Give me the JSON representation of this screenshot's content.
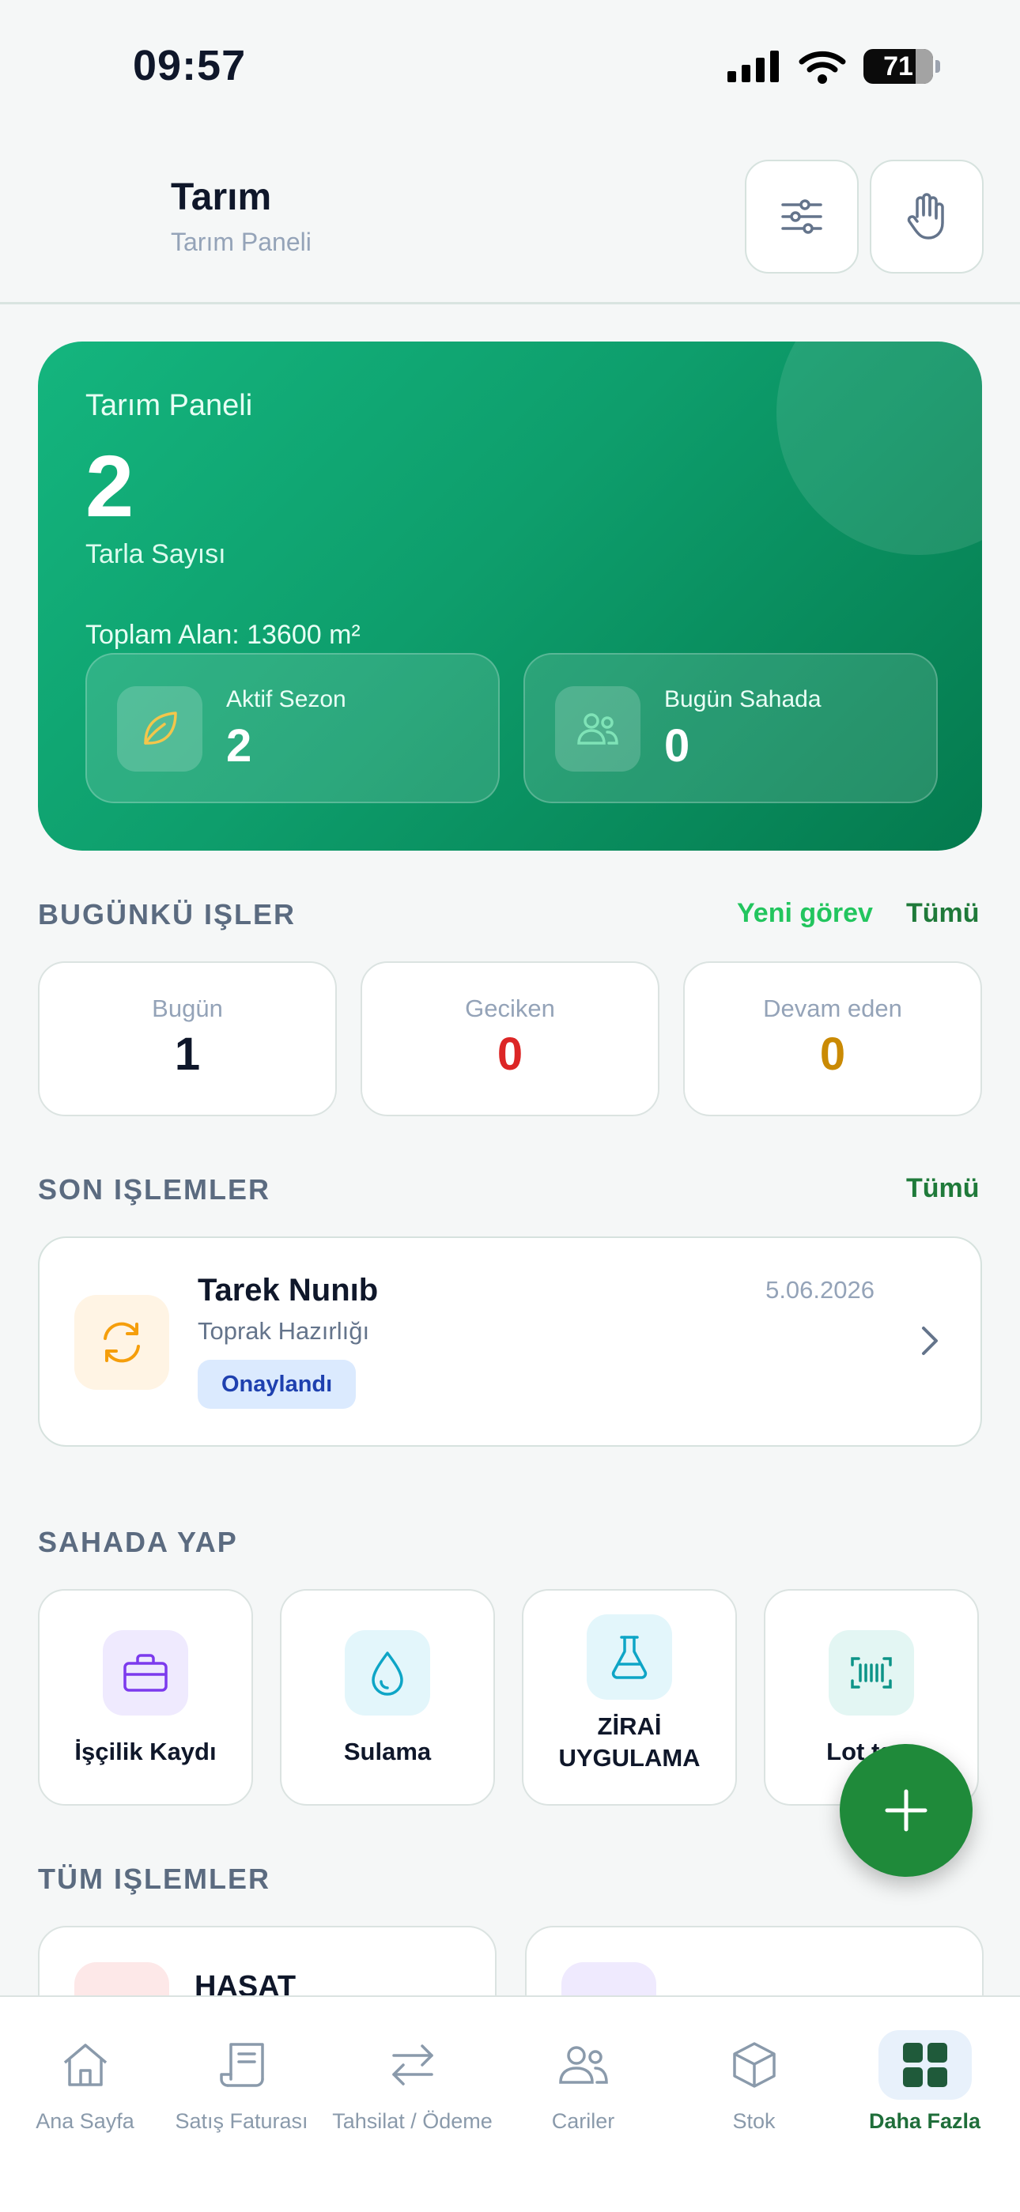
{
  "status_bar": {
    "time": "09:57",
    "battery": "71"
  },
  "header": {
    "title": "Tarım",
    "subtitle": "Tarım Paneli"
  },
  "hero": {
    "label": "Tarım Paneli",
    "value": "2",
    "value_label": "Tarla Sayısı",
    "area": "Toplam Alan: 13600 m²",
    "stats": [
      {
        "label": "Aktif Sezon",
        "value": "2"
      },
      {
        "label": "Bugün Sahada",
        "value": "0"
      }
    ]
  },
  "today": {
    "heading": "BUGÜNKÜ IŞLER",
    "new_task": "Yeni görev",
    "all": "Tümü",
    "tiles": [
      {
        "label": "Bugün",
        "value": "1",
        "color": "#0f172a"
      },
      {
        "label": "Geciken",
        "value": "0",
        "color": "#dc2626"
      },
      {
        "label": "Devam eden",
        "value": "0",
        "color": "#ca8a04"
      }
    ]
  },
  "recent": {
    "heading": "SON IŞLEMLER",
    "all": "Tümü",
    "item": {
      "name": "Tarek Nunıb",
      "date": "5.06.2026",
      "description": "Toprak Hazırlığı",
      "status": "Onaylandı"
    }
  },
  "field": {
    "heading": "SAHADA YAP",
    "items": [
      {
        "label": "İşçilik Kaydı",
        "icon": "briefcase-icon"
      },
      {
        "label": "Sulama",
        "icon": "water-drop-icon"
      },
      {
        "label": "ZİRAİ UYGULAMA",
        "icon": "flask-icon"
      },
      {
        "label": "Lot tara",
        "icon": "barcode-icon"
      }
    ]
  },
  "all_transactions": {
    "heading": "TÜM IŞLEMLER",
    "first_title": "HASAT"
  },
  "nav": {
    "items": [
      {
        "label": "Ana Sayfa"
      },
      {
        "label": "Satış Faturası"
      },
      {
        "label": "Tahsilat / Ödeme"
      },
      {
        "label": "Cariler"
      },
      {
        "label": "Stok"
      },
      {
        "label": "Daha Fazla"
      }
    ]
  },
  "colors": {
    "accent": "#22c55e",
    "brand_green": "#0e9e6c",
    "link_green": "#1f7a3a"
  }
}
